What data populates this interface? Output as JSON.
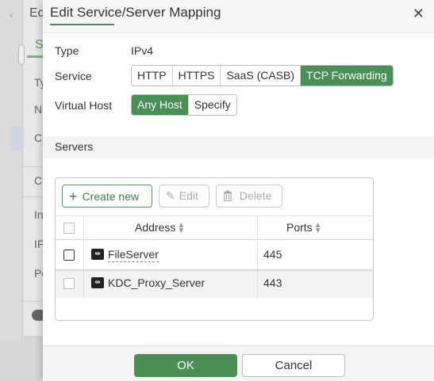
{
  "background": {
    "title": "Ed",
    "tab": "S",
    "labels": [
      "Ty",
      "N",
      "C",
      "C",
      "In",
      "IF",
      "Pc"
    ]
  },
  "dialog": {
    "title": "Edit Service/Server Mapping",
    "close_icon": "close-icon",
    "type": {
      "label": "Type",
      "value": "IPv4"
    },
    "service": {
      "label": "Service",
      "options": [
        "HTTP",
        "HTTPS",
        "SaaS (CASB)",
        "TCP Forwarding"
      ],
      "selected": "TCP Forwarding"
    },
    "virtual_host": {
      "label": "Virtual Host",
      "options": [
        "Any Host",
        "Specify"
      ],
      "selected": "Any Host"
    },
    "servers": {
      "section_title": "Servers",
      "toolbar": {
        "create": "Create new",
        "edit": "Edit",
        "delete": "Delete"
      },
      "columns": {
        "address": "Address",
        "ports": "Ports"
      },
      "rows": [
        {
          "address": "FileServer",
          "ports": "445"
        },
        {
          "address": "KDC_Proxy_Server",
          "ports": "443"
        }
      ]
    },
    "footer": {
      "ok": "OK",
      "cancel": "Cancel"
    },
    "accent_color": "#4a8f55"
  }
}
